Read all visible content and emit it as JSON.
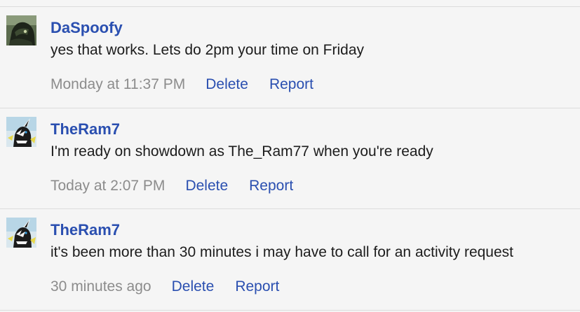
{
  "messages": [
    {
      "author": "DaSpoofy",
      "avatar_icon": "dark-character-avatar",
      "text": "yes that works. Lets do 2pm your time on Friday",
      "time": "Monday at 11:37 PM",
      "delete_label": "Delete",
      "report_label": "Report"
    },
    {
      "author": "TheRam7",
      "avatar_icon": "zebstrika-avatar",
      "text": "I'm ready on showdown as The_Ram77 when you're ready",
      "time": "Today at 2:07 PM",
      "delete_label": "Delete",
      "report_label": "Report"
    },
    {
      "author": "TheRam7",
      "avatar_icon": "zebstrika-avatar",
      "text": "it's been more than 30 minutes i may have to call for an activity request",
      "time": "30 minutes ago",
      "delete_label": "Delete",
      "report_label": "Report"
    }
  ],
  "colors": {
    "link": "#2a4fb0",
    "timestamp": "#8c8c8c",
    "text": "#1c1c1c",
    "background": "#f5f5f5",
    "divider": "#dcdcdc"
  }
}
